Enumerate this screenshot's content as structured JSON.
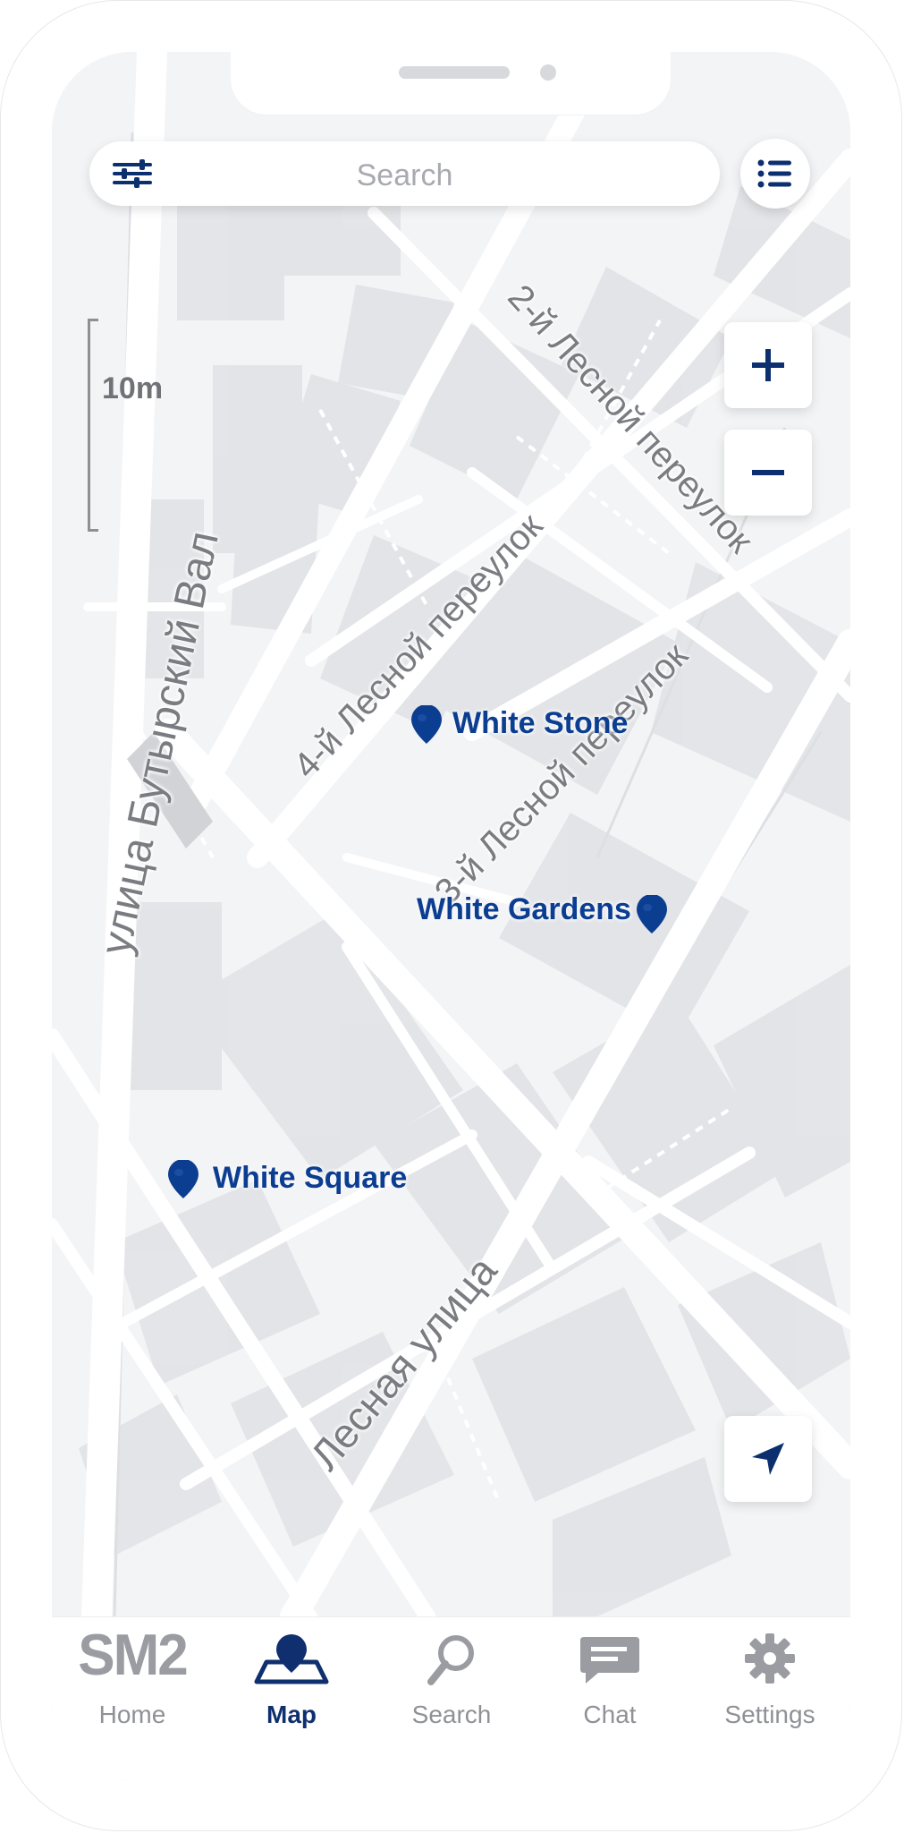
{
  "app": {
    "search_placeholder": "Search",
    "scale_label": "10m"
  },
  "map": {
    "street_names": [
      "2-й Лесной переулок",
      "улица Бутырский Вал",
      "4-й Лесной переулок",
      "3-й Лесной переулок",
      "Лесная улица"
    ],
    "markers": [
      {
        "label": "White Stone",
        "icon": "location-pin-icon"
      },
      {
        "label": "White Gardens",
        "icon": "location-pin-icon"
      },
      {
        "label": "White Square",
        "icon": "location-pin-icon"
      }
    ]
  },
  "controls": {
    "zoom_in_icon": "plus-icon",
    "zoom_out_icon": "minus-icon",
    "locate_icon": "navigation-arrow-icon",
    "filter_icon": "sliders-icon",
    "list_icon": "list-icon"
  },
  "tabs": [
    {
      "label": "Home",
      "logo": "SM2",
      "icon": "sm2-logo-icon",
      "active": false
    },
    {
      "label": "Map",
      "icon": "map-pin-icon",
      "active": true
    },
    {
      "label": "Search",
      "icon": "search-icon",
      "active": false
    },
    {
      "label": "Chat",
      "icon": "chat-icon",
      "active": false
    },
    {
      "label": "Settings",
      "icon": "gear-icon",
      "active": false
    }
  ],
  "colors": {
    "accent": "#0B3D91",
    "active_tab": "#0F2F6F",
    "map_background": "#F3F4F6",
    "building": "#E3E4E7",
    "road": "#FFFFFF",
    "muted_text": "#8F9197"
  }
}
